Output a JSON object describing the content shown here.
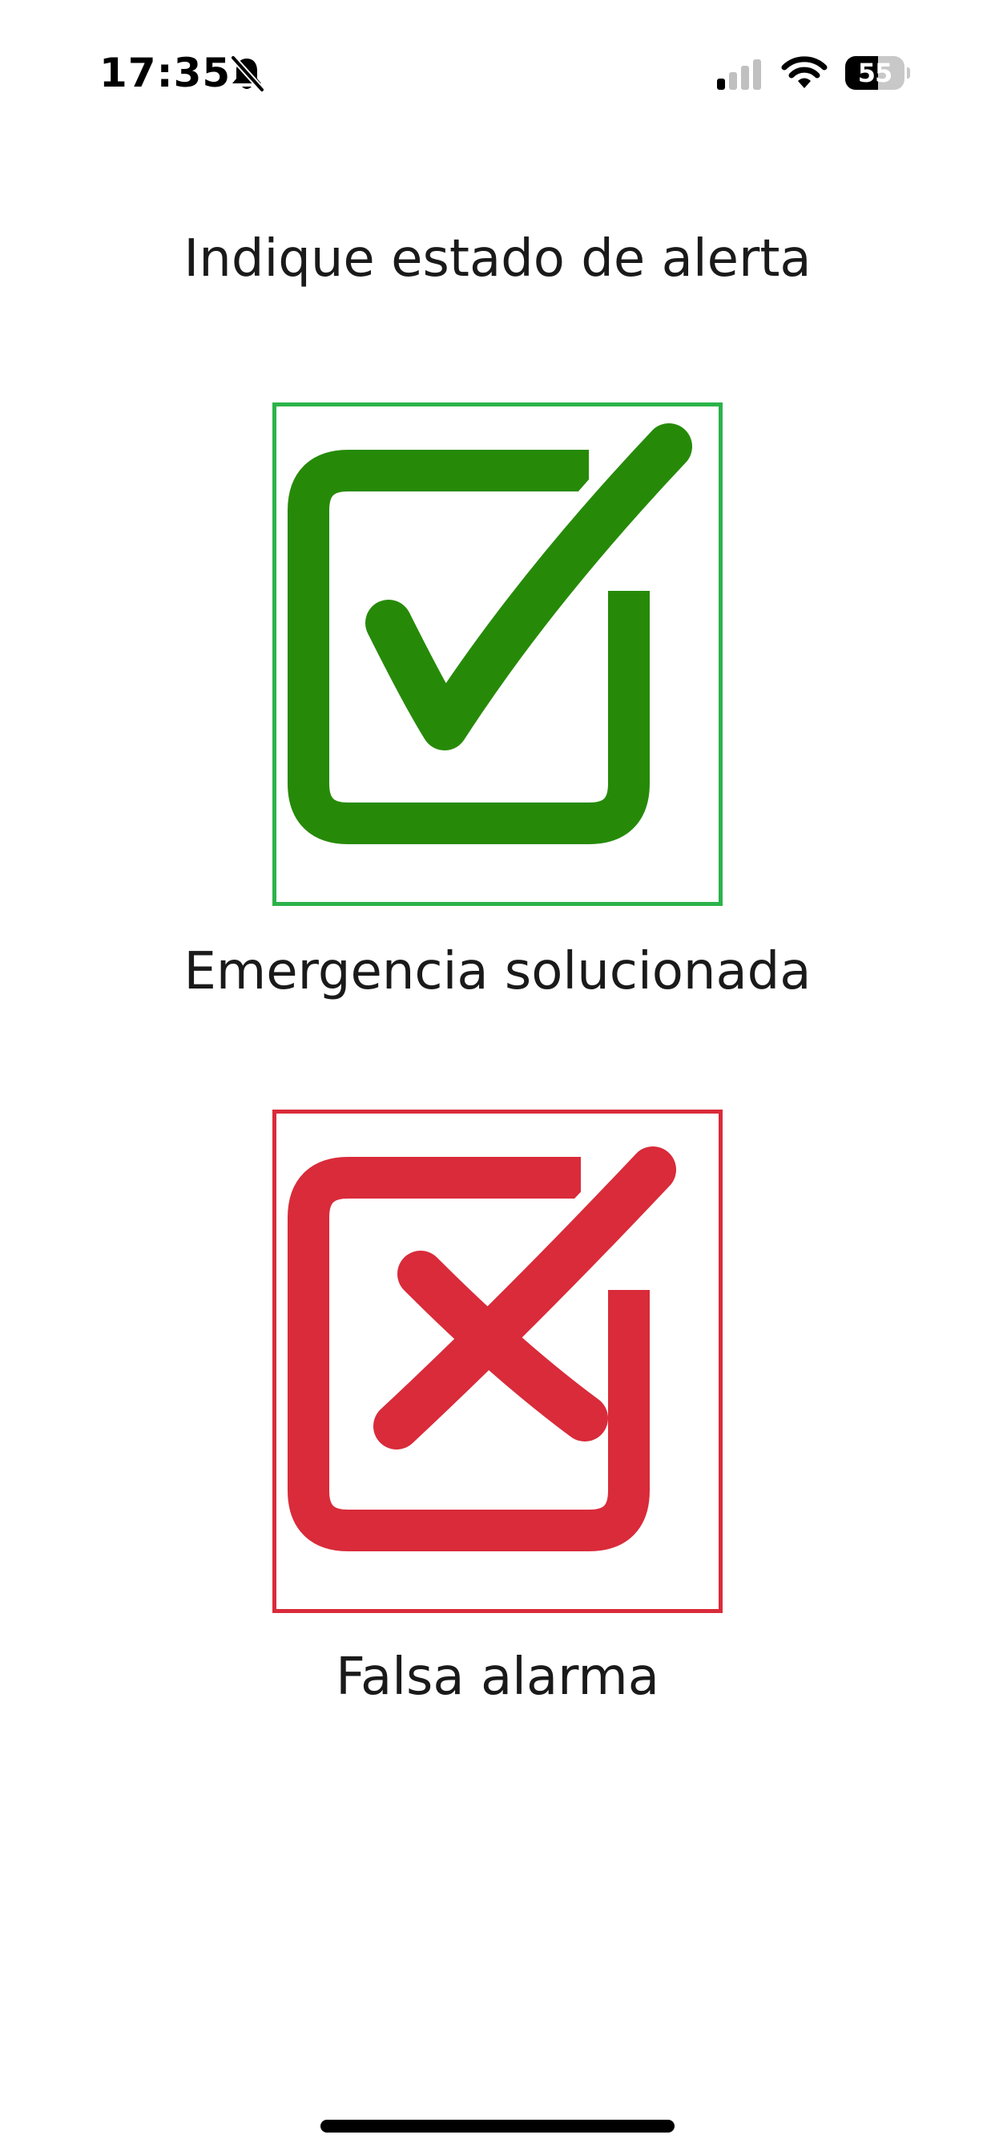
{
  "status_bar": {
    "time": "17:35",
    "battery_level": "55",
    "battery_fraction": 0.55,
    "signal_bars_active": 1,
    "signal_bars_total": 4
  },
  "screen": {
    "title": "Indique estado de alerta"
  },
  "options": [
    {
      "label": "Emergencia solucionada",
      "icon": "check-box-icon",
      "color": "#268a08",
      "border_color": "#2bb34a"
    },
    {
      "label": "Falsa alarma",
      "icon": "cross-box-icon",
      "color": "#d92b3a",
      "border_color": "#d92b3a"
    }
  ]
}
